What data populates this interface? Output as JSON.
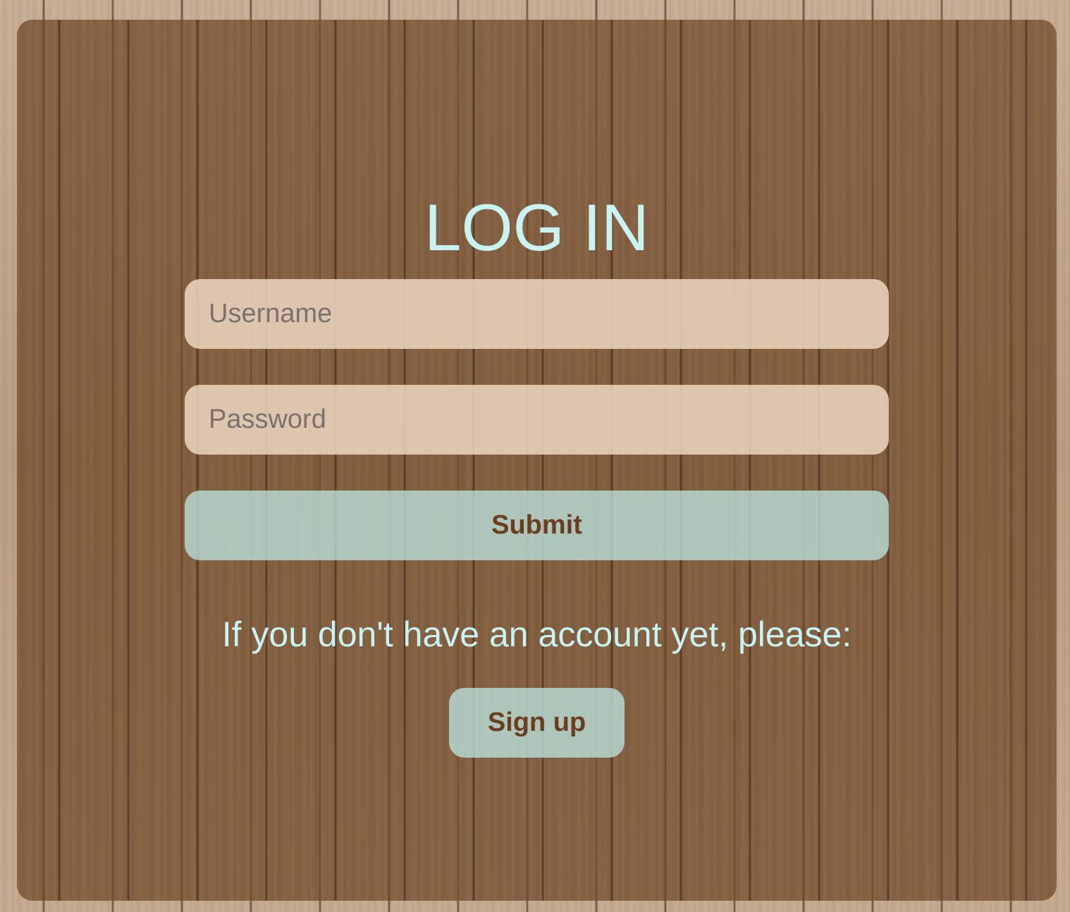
{
  "login": {
    "title": "LOG IN",
    "username_placeholder": "Username",
    "password_placeholder": "Password",
    "submit_label": "Submit",
    "signup_prompt": "If you don't have an account yet, please:",
    "signup_label": "Sign up"
  },
  "colors": {
    "title_text": "#c9f3f2",
    "input_background": "#ecd6c0",
    "button_background": "#b9deda",
    "button_text": "#6b3e20",
    "panel_overlay": "#6e4626"
  }
}
